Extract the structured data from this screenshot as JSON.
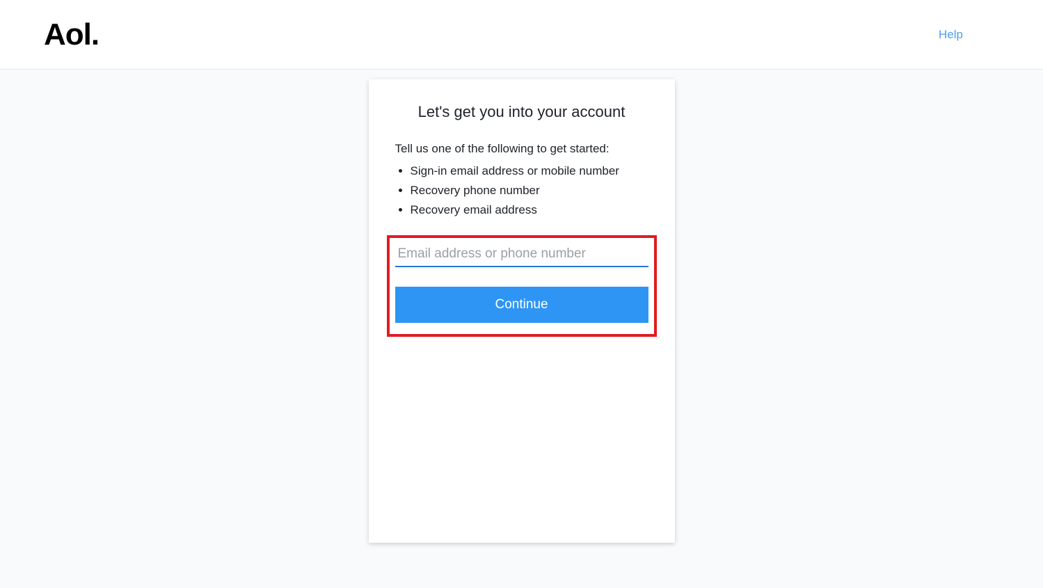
{
  "header": {
    "logo_text": "Aol.",
    "help_label": "Help"
  },
  "card": {
    "title": "Let's get you into your account",
    "instruction": "Tell us one of the following to get started:",
    "options": [
      "Sign-in email address or mobile number",
      "Recovery phone number",
      "Recovery email address"
    ],
    "input_placeholder": "Email address or phone number",
    "input_value": "",
    "continue_label": "Continue"
  }
}
